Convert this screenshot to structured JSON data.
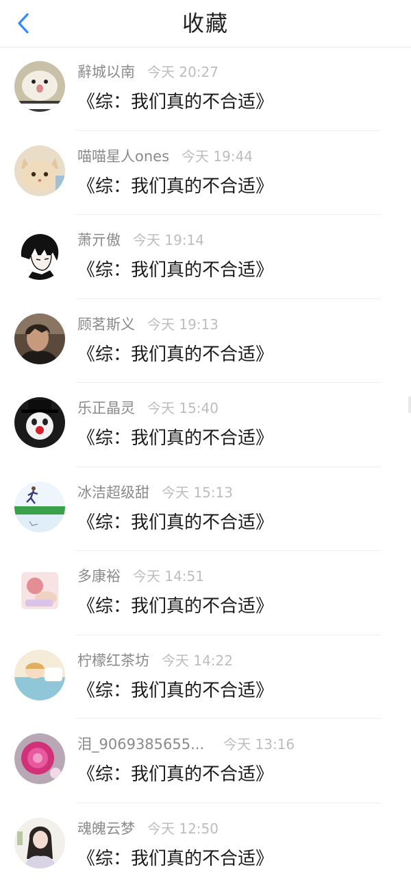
{
  "header": {
    "title": "收藏",
    "back_icon": "chevron-left-icon",
    "accent_color": "#2e8bff"
  },
  "favorites": [
    {
      "user": "辭城以南",
      "time": "今天 20:27",
      "title": "《综：我们真的不合适》",
      "avatar_icon": "hamster-avatar"
    },
    {
      "user": "喵喵星人ones",
      "time": "今天 19:44",
      "title": "《综：我们真的不合适》",
      "avatar_icon": "kitten-avatar"
    },
    {
      "user": "萧亓傲",
      "time": "今天 19:14",
      "title": "《综：我们真的不合适》",
      "avatar_icon": "anime-boy-avatar"
    },
    {
      "user": "顾茗斯义",
      "time": "今天 19:13",
      "title": "《综：我们真的不合适》",
      "avatar_icon": "portrait-avatar"
    },
    {
      "user": "乐正晶灵",
      "time": "今天 15:40",
      "title": "《综：我们真的不合适》",
      "avatar_icon": "clown-avatar"
    },
    {
      "user": "冰洁超级甜",
      "time": "今天 15:13",
      "title": "《综：我们真的不合适》",
      "avatar_icon": "runner-avatar"
    },
    {
      "user": "多康裕",
      "time": "今天 14:51",
      "title": "《综：我们真的不合适》",
      "avatar_icon": "cartoon-avatar"
    },
    {
      "user": "柠檬红茶坊",
      "time": "今天 14:22",
      "title": "《综：我们真的不合适》",
      "avatar_icon": "sleeping-avatar"
    },
    {
      "user": "泪_9069385655...",
      "time": "今天 13:16",
      "title": "《综：我们真的不合适》",
      "avatar_icon": "flower-avatar"
    },
    {
      "user": "魂魄云梦",
      "time": "今天 12:50",
      "title": "《综：我们真的不合适》",
      "avatar_icon": "girl-avatar"
    }
  ]
}
